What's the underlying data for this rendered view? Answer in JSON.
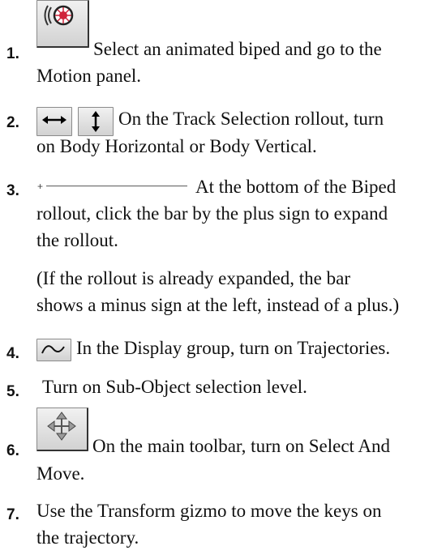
{
  "steps": [
    {
      "number": "1.",
      "lines": [
        "Select an animated biped and go to the",
        "Motion panel."
      ],
      "icons": [
        "motion-panel-icon"
      ]
    },
    {
      "number": "2.",
      "lines": [
        "On the Track Selection rollout, turn",
        "on Body Horizontal or Body Vertical."
      ],
      "icons": [
        "body-horizontal-icon",
        "body-vertical-icon"
      ]
    },
    {
      "number": "3.",
      "lines": [
        "At the bottom of the Biped",
        "rollout, click the bar by the plus sign to expand",
        "the rollout."
      ],
      "icons": [
        "rollout-expand-bar"
      ]
    },
    {
      "note": [
        "(If the rollout is already expanded, the bar",
        "shows a minus sign at the left, instead of a plus.)"
      ]
    },
    {
      "number": "4.",
      "lines": [
        "In the Display group, turn on Trajectories."
      ],
      "icons": [
        "trajectories-icon"
      ]
    },
    {
      "number": "5.",
      "lines": [
        "Turn on Sub-Object selection level."
      ]
    },
    {
      "number": "6.",
      "lines": [
        "On the main toolbar, turn on Select And",
        "Move."
      ],
      "icons": [
        "select-and-move-icon"
      ]
    },
    {
      "number": "7.",
      "lines": [
        "Use the Transform gizmo to move the keys on",
        "the trajectory."
      ]
    }
  ],
  "icon_symbols": {
    "rollout_plus": "+"
  },
  "colors": {
    "text": "#111111",
    "motion_icon_accent": "#d0243a",
    "button_face": "#e0e0e0"
  }
}
